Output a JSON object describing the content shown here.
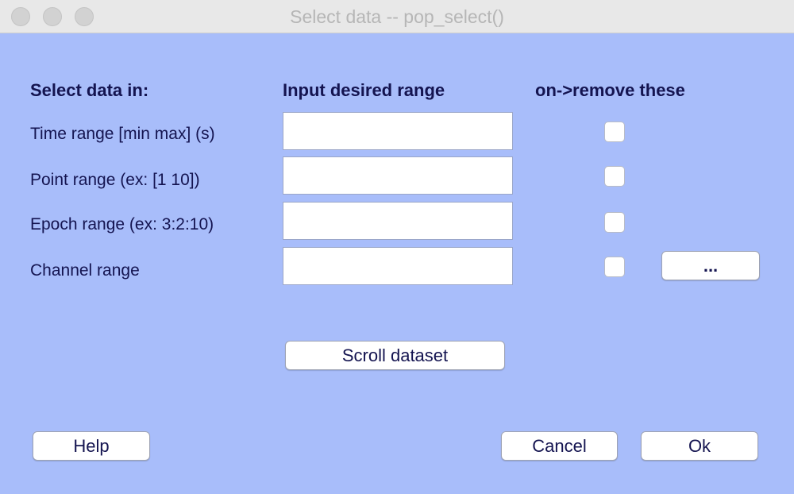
{
  "window": {
    "title": "Select data -- pop_select()",
    "background": "#a8bdfa"
  },
  "headers": {
    "select_in": "Select data in:",
    "input_range": "Input desired range",
    "remove": "on->remove these"
  },
  "rows": [
    {
      "label": "Time range [min max] (s)",
      "value": "",
      "remove_checked": false
    },
    {
      "label": "Point range (ex: [1 10])",
      "value": "",
      "remove_checked": false
    },
    {
      "label": "Epoch range (ex: 3:2:10)",
      "value": "",
      "remove_checked": false
    },
    {
      "label": "Channel range",
      "value": "",
      "remove_checked": false
    }
  ],
  "buttons": {
    "channel_browse": "...",
    "scroll_dataset": "Scroll dataset",
    "help": "Help",
    "cancel": "Cancel",
    "ok": "Ok"
  }
}
